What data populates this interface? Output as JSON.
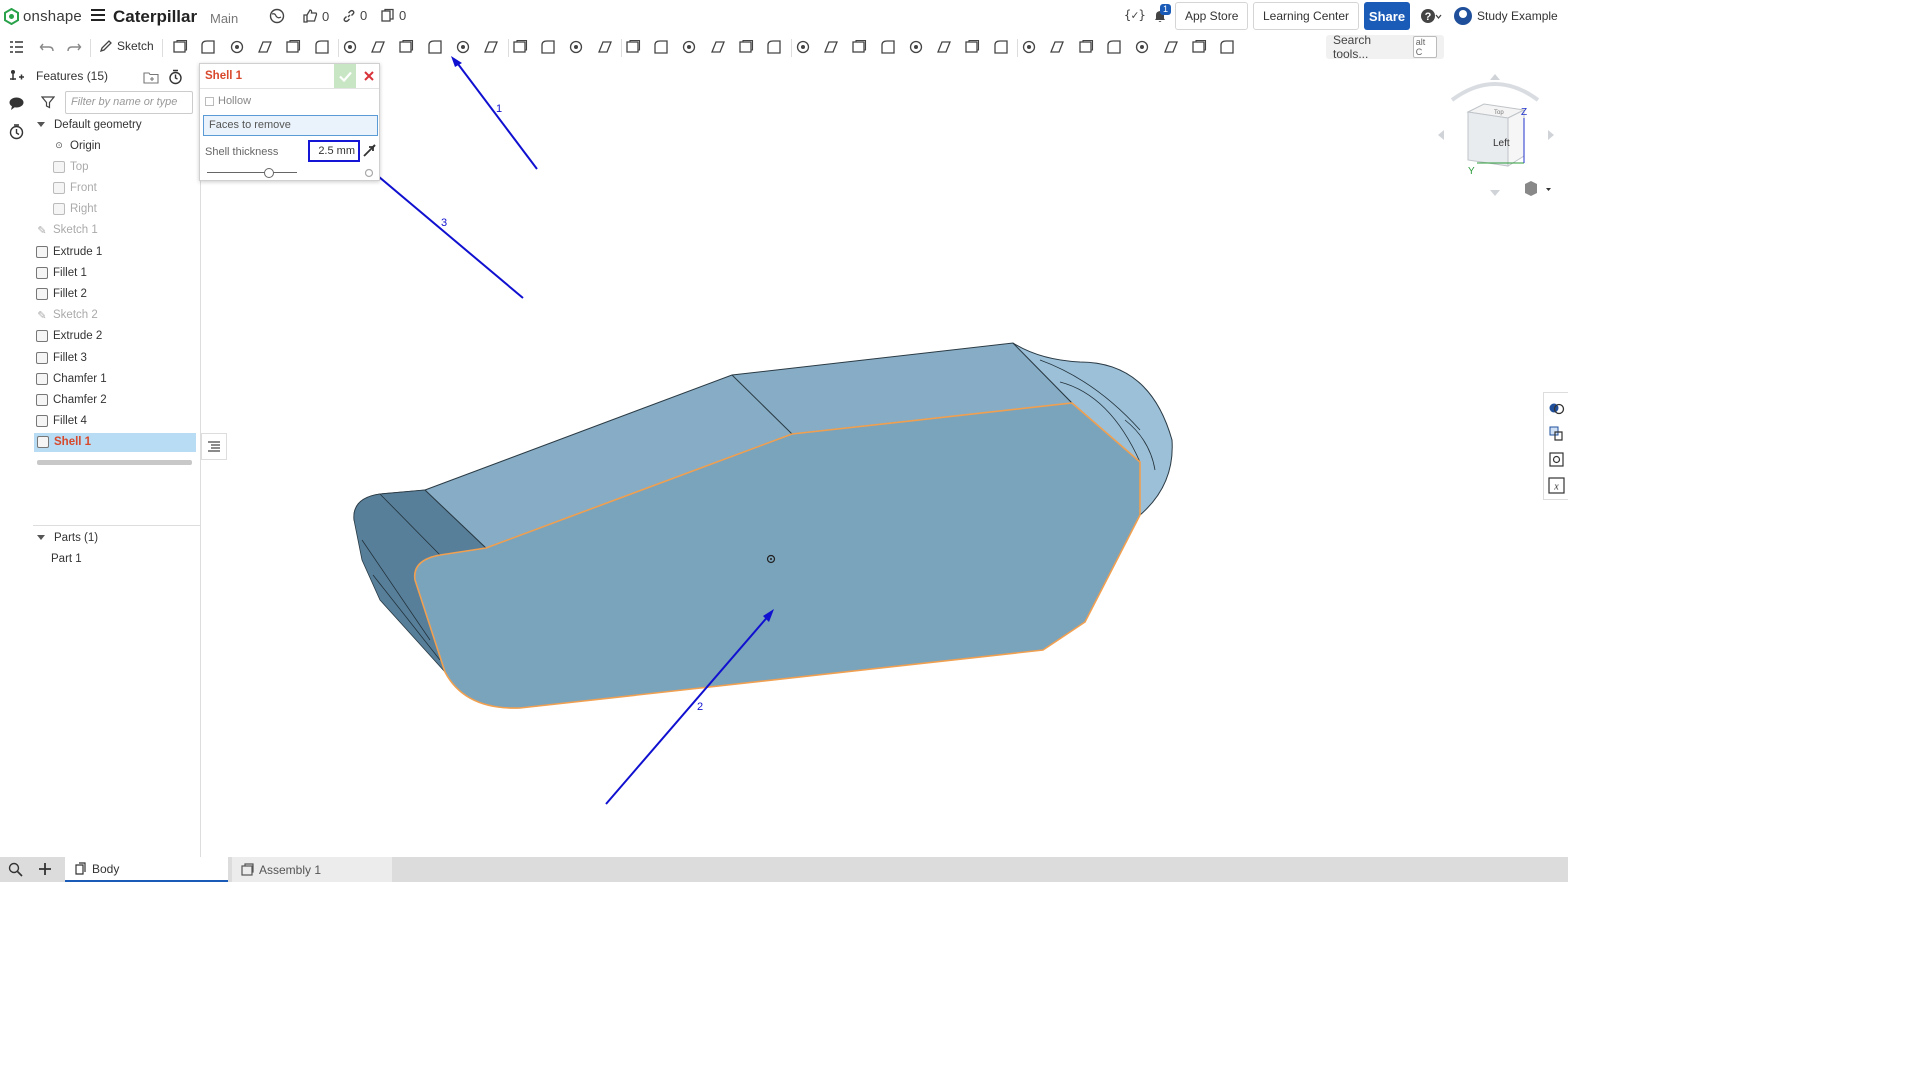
{
  "header": {
    "brand": "onshape",
    "doc_title": "Caterpillar",
    "branch": "Main",
    "likes": "0",
    "links": "0",
    "copies": "0",
    "notif_count": "1",
    "app_store": "App Store",
    "learning_center": "Learning Center",
    "share": "Share",
    "user": "Study Example"
  },
  "toolbar": {
    "sketch_label": "Sketch",
    "search_tools": "Search tools...",
    "search_shortcut": "alt C"
  },
  "features": {
    "header": "Features (15)",
    "filter_placeholder": "Filter by name or type",
    "default_geometry": "Default geometry",
    "items": [
      {
        "label": "Origin"
      },
      {
        "label": "Top"
      },
      {
        "label": "Front"
      },
      {
        "label": "Right"
      },
      {
        "label": "Sketch 1"
      },
      {
        "label": "Extrude 1"
      },
      {
        "label": "Fillet 1"
      },
      {
        "label": "Fillet 2"
      },
      {
        "label": "Sketch 2"
      },
      {
        "label": "Extrude 2"
      },
      {
        "label": "Fillet 3"
      },
      {
        "label": "Chamfer 1"
      },
      {
        "label": "Chamfer 2"
      },
      {
        "label": "Fillet 4"
      },
      {
        "label": "Shell 1"
      }
    ],
    "parts_header": "Parts (1)",
    "parts": [
      {
        "label": "Part 1"
      }
    ]
  },
  "shell_dialog": {
    "title": "Shell 1",
    "hollow_label": "Hollow",
    "faces_label": "Faces to remove",
    "thickness_label": "Shell thickness",
    "thickness_value": "2.5 mm"
  },
  "view_cube": {
    "face_label": "Left",
    "top_label": "Top",
    "axis_z": "Z",
    "axis_y": "Y"
  },
  "annotations": {
    "arrow1": "1",
    "arrow2": "2",
    "arrow3": "3",
    "color": "#1010d0"
  },
  "tabs": [
    {
      "label": "Body"
    },
    {
      "label": "Assembly 1"
    }
  ],
  "colors": {
    "part_face": "#7aa3bc",
    "part_top": "#86adc5",
    "highlight_edge": "#f0a050",
    "share_blue": "#1a5bb8",
    "accent_red": "#d8482b"
  }
}
